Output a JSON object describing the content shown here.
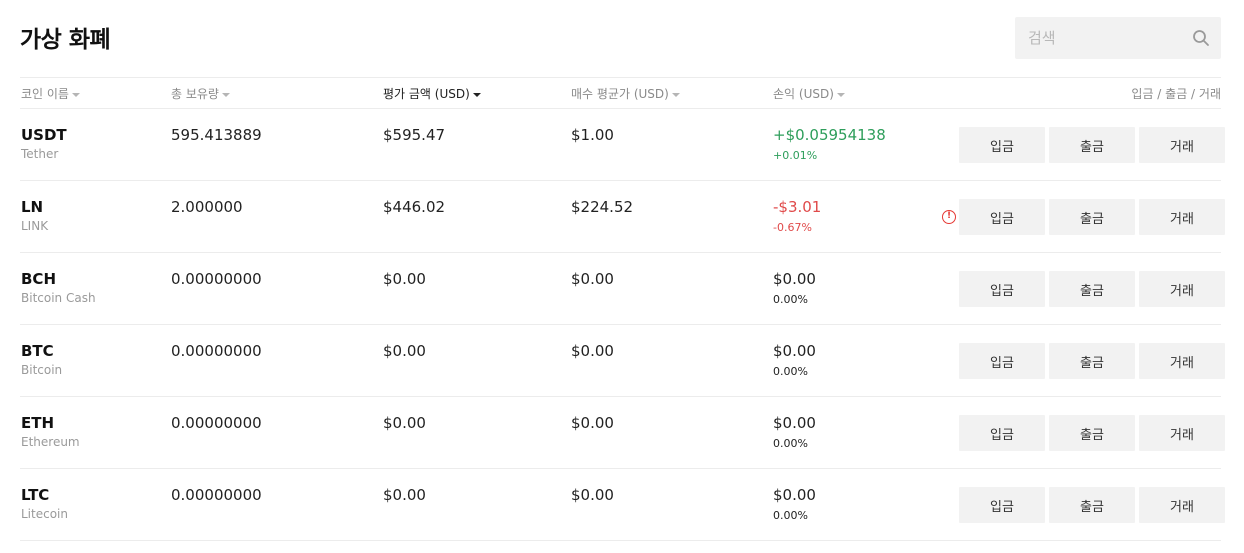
{
  "page": {
    "title": "가상 화폐"
  },
  "search": {
    "placeholder": "검색"
  },
  "columns": {
    "coin_name": "코인 이름",
    "total_holdings": "총 보유량",
    "eval_amount": "평가 금액 (USD)",
    "avg_buy_price": "매수 평균가 (USD)",
    "profit_loss": "손익 (USD)",
    "actions": "입금 / 출금 / 거래"
  },
  "buttons": {
    "deposit": "입금",
    "withdraw": "출금",
    "trade": "거래"
  },
  "colors": {
    "positive": "#2e9e5b",
    "negative": "#e04a4a",
    "neutral": "#222222"
  },
  "rows": [
    {
      "symbol": "USDT",
      "name": "Tether",
      "holdings": "595.413889",
      "eval": "$595.47",
      "avg": "$1.00",
      "pl": "+$0.05954138",
      "pl_pct": "+0.01%",
      "trend": "positive",
      "warning": false
    },
    {
      "symbol": "LN",
      "name": "LINK",
      "holdings": "2.000000",
      "eval": "$446.02",
      "avg": "$224.52",
      "pl": "-$3.01",
      "pl_pct": "-0.67%",
      "trend": "negative",
      "warning": true
    },
    {
      "symbol": "BCH",
      "name": "Bitcoin Cash",
      "holdings": "0.00000000",
      "eval": "$0.00",
      "avg": "$0.00",
      "pl": "$0.00",
      "pl_pct": "0.00%",
      "trend": "neutral",
      "warning": false
    },
    {
      "symbol": "BTC",
      "name": "Bitcoin",
      "holdings": "0.00000000",
      "eval": "$0.00",
      "avg": "$0.00",
      "pl": "$0.00",
      "pl_pct": "0.00%",
      "trend": "neutral",
      "warning": false
    },
    {
      "symbol": "ETH",
      "name": "Ethereum",
      "holdings": "0.00000000",
      "eval": "$0.00",
      "avg": "$0.00",
      "pl": "$0.00",
      "pl_pct": "0.00%",
      "trend": "neutral",
      "warning": false
    },
    {
      "symbol": "LTC",
      "name": "Litecoin",
      "holdings": "0.00000000",
      "eval": "$0.00",
      "avg": "$0.00",
      "pl": "$0.00",
      "pl_pct": "0.00%",
      "trend": "neutral",
      "warning": false
    }
  ],
  "icons": {
    "search": "search-icon",
    "warning": "warning-icon"
  }
}
